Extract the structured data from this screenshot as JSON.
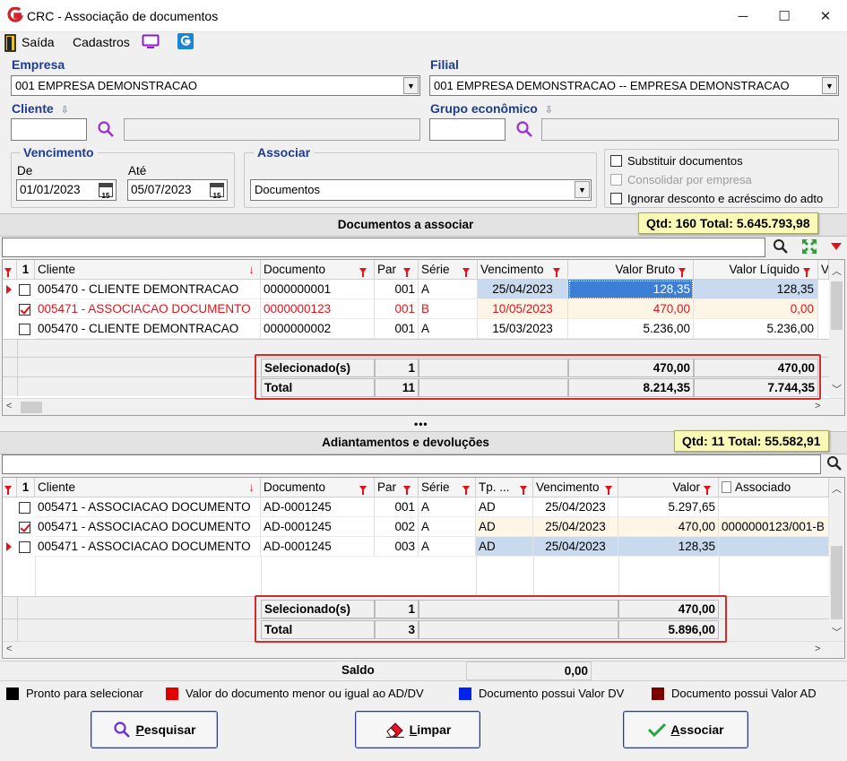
{
  "window": {
    "title": "CRC - Associação de documentos"
  },
  "menu": {
    "exit": "Saída",
    "registrations": "Cadastros"
  },
  "form": {
    "company_label": "Empresa",
    "company_value": "001 EMPRESA DEMONSTRACAO",
    "branch_label": "Filial",
    "branch_value": "001 EMPRESA DEMONSTRACAO -- EMPRESA DEMONSTRACAO",
    "client_label": "Cliente",
    "group_label": "Grupo econômico",
    "due_group": "Vencimento",
    "from_label": "De",
    "from_value": "01/01/2023",
    "to_label": "Até",
    "to_value": "05/07/2023",
    "assoc_group": "Associar",
    "assoc_value": "Documentos",
    "opt_replace": "Substituir documentos",
    "opt_consolidate": "Consolidar por empresa",
    "opt_ignore": "Ignorar desconto e acréscimo do adto",
    "cal_day": "15"
  },
  "docs": {
    "title": "Documentos a associar",
    "summary": "Qtd: 160 Total: 5.645.793,98",
    "columns": {
      "idx": "1",
      "client": "Cliente",
      "document": "Documento",
      "par": "Par",
      "serie": "Série",
      "due": "Vencimento",
      "gross": "Valor Bruto",
      "net": "Valor Líquido",
      "more": "V"
    },
    "rows": [
      {
        "client": "005470 - CLIENTE DEMONTRACAO",
        "document": "0000000001",
        "par": "001",
        "serie": "A",
        "due": "25/04/2023",
        "gross": "128,35",
        "net": "128,35",
        "checked": false
      },
      {
        "client": "005471 - ASSOCIACAO DOCUMENTO",
        "document": "0000000123",
        "par": "001",
        "serie": "B",
        "due": "10/05/2023",
        "gross": "470,00",
        "net": "0,00",
        "checked": true
      },
      {
        "client": "005470 - CLIENTE DEMONTRACAO",
        "document": "0000000002",
        "par": "001",
        "serie": "A",
        "due": "15/03/2023",
        "gross": "5.236,00",
        "net": "5.236,00",
        "checked": false
      }
    ],
    "selected_label": "Selecionado(s)",
    "selected_count": "1",
    "selected_gross": "470,00",
    "selected_net": "470,00",
    "total_label": "Total",
    "total_count": "11",
    "total_gross": "8.214,35",
    "total_net": "7.744,35"
  },
  "splitter": "•••",
  "adv": {
    "title": "Adiantamentos e devoluções",
    "summary": "Qtd: 11 Total: 55.582,91",
    "columns": {
      "idx": "1",
      "client": "Cliente",
      "document": "Documento",
      "par": "Par",
      "serie": "Série",
      "type": "Tp. ...",
      "due": "Vencimento",
      "value": "Valor",
      "assoc": "Associado"
    },
    "rows": [
      {
        "client": "005471 - ASSOCIACAO DOCUMENTO",
        "document": "AD-0001245",
        "par": "001",
        "serie": "A",
        "type": "AD",
        "due": "25/04/2023",
        "value": "5.297,65",
        "assoc": "",
        "checked": false
      },
      {
        "client": "005471 - ASSOCIACAO DOCUMENTO",
        "document": "AD-0001245",
        "par": "002",
        "serie": "A",
        "type": "AD",
        "due": "25/04/2023",
        "value": "470,00",
        "assoc": "0000000123/001-B",
        "checked": true
      },
      {
        "client": "005471 - ASSOCIACAO DOCUMENTO",
        "document": "AD-0001245",
        "par": "003",
        "serie": "A",
        "type": "AD",
        "due": "25/04/2023",
        "value": "128,35",
        "assoc": "",
        "checked": false
      }
    ],
    "selected_label": "Selecionado(s)",
    "selected_count": "1",
    "selected_value": "470,00",
    "total_label": "Total",
    "total_count": "3",
    "total_value": "5.896,00"
  },
  "balance": {
    "label": "Saldo",
    "value": "0,00"
  },
  "legend": [
    {
      "color": "#000000",
      "text": "Pronto para selecionar"
    },
    {
      "color": "#e00000",
      "text": "Valor do documento menor ou igual ao AD/DV"
    },
    {
      "color": "#0022ee",
      "text": "Documento possui Valor DV"
    },
    {
      "color": "#7a0000",
      "text": "Documento possui Valor AD"
    }
  ],
  "buttons": {
    "search_key": "P",
    "search_rest": "esquisar",
    "clear_key": "L",
    "clear_rest": "impar",
    "assoc_key": "A",
    "assoc_rest": "ssociar"
  }
}
